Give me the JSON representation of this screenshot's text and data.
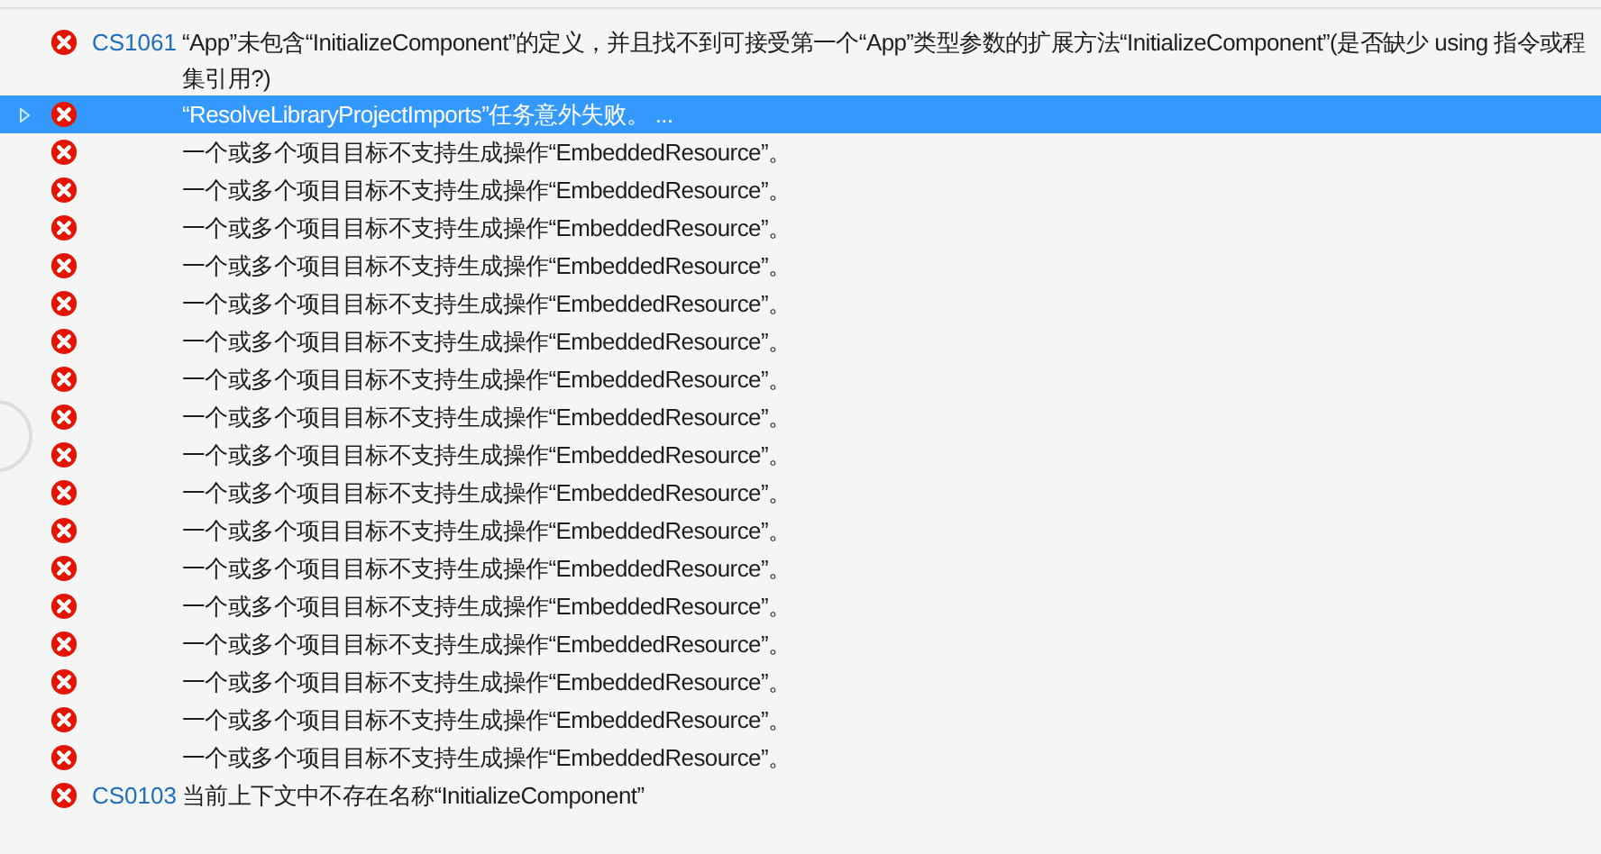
{
  "errors": [
    {
      "code": "CS1061",
      "selected": false,
      "expandable": false,
      "message_lines": [
        "“App”未包含“InitializeComponent”的定义，并且找不到可接受第一个“App”类型参数的扩展方法“InitializeComponent”(是否缺少 using 指令或程",
        "集引用?)"
      ]
    },
    {
      "selected": true,
      "expandable": true,
      "message_lines": [
        "“ResolveLibraryProjectImports”任务意外失败。 ..."
      ]
    },
    {
      "selected": false,
      "expandable": false,
      "message_lines": [
        "一个或多个项目目标不支持生成操作“EmbeddedResource”。"
      ]
    },
    {
      "selected": false,
      "expandable": false,
      "message_lines": [
        "一个或多个项目目标不支持生成操作“EmbeddedResource”。"
      ]
    },
    {
      "selected": false,
      "expandable": false,
      "message_lines": [
        "一个或多个项目目标不支持生成操作“EmbeddedResource”。"
      ]
    },
    {
      "selected": false,
      "expandable": false,
      "message_lines": [
        "一个或多个项目目标不支持生成操作“EmbeddedResource”。"
      ]
    },
    {
      "selected": false,
      "expandable": false,
      "message_lines": [
        "一个或多个项目目标不支持生成操作“EmbeddedResource”。"
      ]
    },
    {
      "selected": false,
      "expandable": false,
      "message_lines": [
        "一个或多个项目目标不支持生成操作“EmbeddedResource”。"
      ]
    },
    {
      "selected": false,
      "expandable": false,
      "message_lines": [
        "一个或多个项目目标不支持生成操作“EmbeddedResource”。"
      ]
    },
    {
      "selected": false,
      "expandable": false,
      "message_lines": [
        "一个或多个项目目标不支持生成操作“EmbeddedResource”。"
      ]
    },
    {
      "selected": false,
      "expandable": false,
      "message_lines": [
        "一个或多个项目目标不支持生成操作“EmbeddedResource”。"
      ]
    },
    {
      "selected": false,
      "expandable": false,
      "message_lines": [
        "一个或多个项目目标不支持生成操作“EmbeddedResource”。"
      ]
    },
    {
      "selected": false,
      "expandable": false,
      "message_lines": [
        "一个或多个项目目标不支持生成操作“EmbeddedResource”。"
      ]
    },
    {
      "selected": false,
      "expandable": false,
      "message_lines": [
        "一个或多个项目目标不支持生成操作“EmbeddedResource”。"
      ]
    },
    {
      "selected": false,
      "expandable": false,
      "message_lines": [
        "一个或多个项目目标不支持生成操作“EmbeddedResource”。"
      ]
    },
    {
      "selected": false,
      "expandable": false,
      "message_lines": [
        "一个或多个项目目标不支持生成操作“EmbeddedResource”。"
      ]
    },
    {
      "selected": false,
      "expandable": false,
      "message_lines": [
        "一个或多个项目目标不支持生成操作“EmbeddedResource”。"
      ]
    },
    {
      "selected": false,
      "expandable": false,
      "message_lines": [
        "一个或多个项目目标不支持生成操作“EmbeddedResource”。"
      ]
    },
    {
      "selected": false,
      "expandable": false,
      "message_lines": [
        "一个或多个项目目标不支持生成操作“EmbeddedResource”。"
      ]
    },
    {
      "code": "CS0103",
      "selected": false,
      "expandable": false,
      "message_lines": [
        "当前上下文中不存在名称“InitializeComponent”"
      ]
    }
  ]
}
